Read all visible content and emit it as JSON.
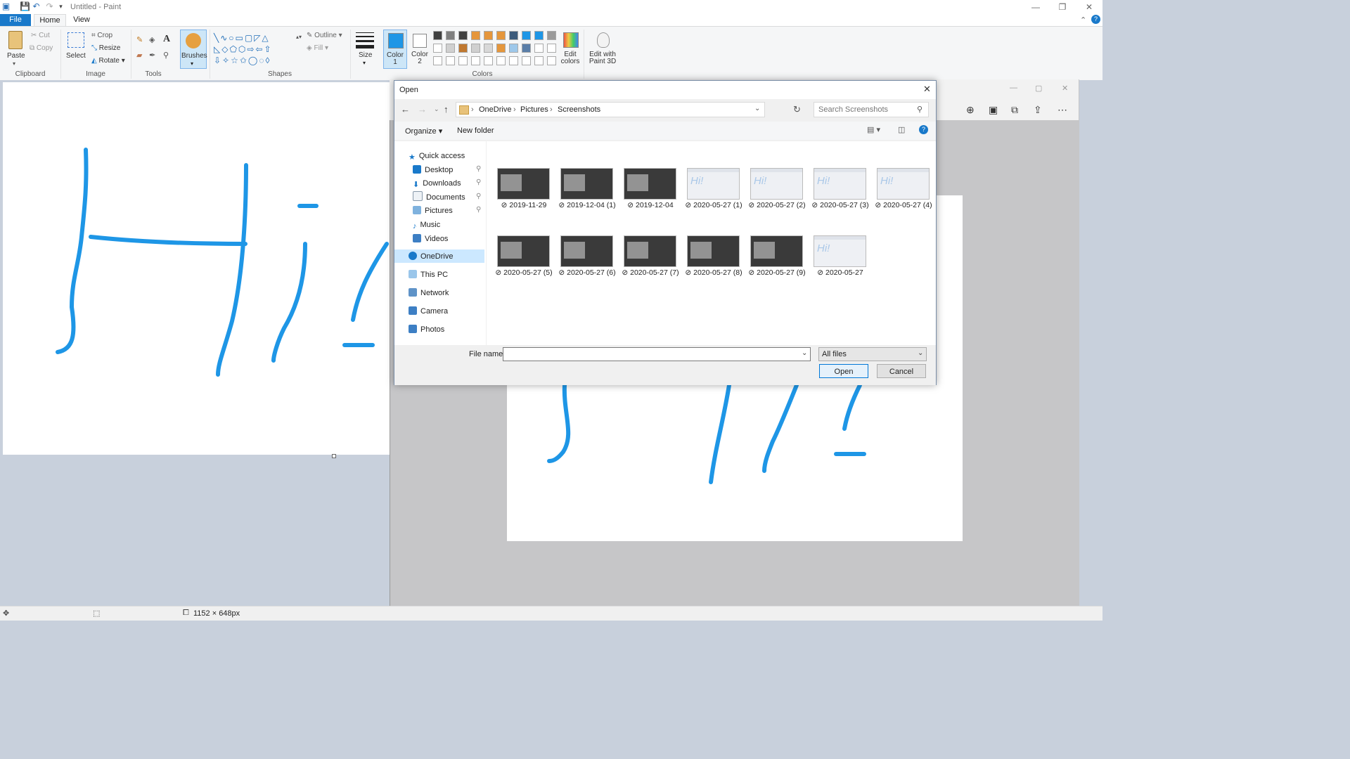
{
  "window": {
    "title": "Untitled - Paint"
  },
  "ribbon": {
    "tabs": [
      "File",
      "Home",
      "View"
    ],
    "clipboard": {
      "paste": "Paste",
      "cut": "Cut",
      "copy": "Copy",
      "label": "Clipboard"
    },
    "image": {
      "select": "Select",
      "crop": "Crop",
      "resize": "Resize",
      "rotate": "Rotate",
      "label": "Image"
    },
    "tools": {
      "label": "Tools"
    },
    "brushes": {
      "label": "Brushes"
    },
    "shapes": {
      "outline": "Outline",
      "fill": "Fill",
      "label": "Shapes"
    },
    "size": {
      "label": "Size"
    },
    "colors": {
      "color1": "Color 1",
      "color2": "Color 2",
      "edit": "Edit colors",
      "label": "Colors",
      "color1_value": "#1e96e6",
      "palette_row1": [
        "#404040",
        "#7f7f7f",
        "#404040",
        "#e5963c",
        "#e5963c",
        "#e5963c",
        "#3c5a7a",
        "#1e96e6",
        "#1e96e6",
        "#9a9a9a"
      ],
      "palette_row2": [
        "#ffffff",
        "#d0d0d0",
        "#c07830",
        "#d0d0d0",
        "#d8d8d8",
        "#e5963c",
        "#9ec8ea",
        "#5a7ea8",
        "#ffffff",
        "#ffffff"
      ]
    },
    "paint3d": {
      "label": "Edit with Paint 3D"
    }
  },
  "status": {
    "dimensions": "1152 × 648px"
  },
  "dialog": {
    "title": "Open",
    "breadcrumb": [
      "OneDrive",
      "Pictures",
      "Screenshots"
    ],
    "search_placeholder": "Search Screenshots",
    "organize": "Organize",
    "new_folder": "New folder",
    "nav": {
      "quick_access": "Quick access",
      "items": [
        "Desktop",
        "Downloads",
        "Documents",
        "Pictures",
        "Music",
        "Videos"
      ],
      "onedrive": "OneDrive",
      "this_pc": "This PC",
      "network": "Network",
      "camera": "Camera",
      "photos": "Photos"
    },
    "files": [
      {
        "name": "2019-11-29",
        "style": "dark"
      },
      {
        "name": "2019-12-04 (1)",
        "style": "dark"
      },
      {
        "name": "2019-12-04",
        "style": "dark"
      },
      {
        "name": "2020-05-27 (1)",
        "style": "light"
      },
      {
        "name": "2020-05-27 (2)",
        "style": "light"
      },
      {
        "name": "2020-05-27 (3)",
        "style": "light"
      },
      {
        "name": "2020-05-27 (4)",
        "style": "light"
      },
      {
        "name": "2020-05-27 (5)",
        "style": "dark"
      },
      {
        "name": "2020-05-27 (6)",
        "style": "dark"
      },
      {
        "name": "2020-05-27 (7)",
        "style": "dark"
      },
      {
        "name": "2020-05-27 (8)",
        "style": "dark"
      },
      {
        "name": "2020-05-27 (9)",
        "style": "dark"
      },
      {
        "name": "2020-05-27",
        "style": "light"
      }
    ],
    "file_name_label": "File name:",
    "file_name_value": "",
    "file_type": "All files",
    "open_button": "Open",
    "cancel_button": "Cancel"
  }
}
